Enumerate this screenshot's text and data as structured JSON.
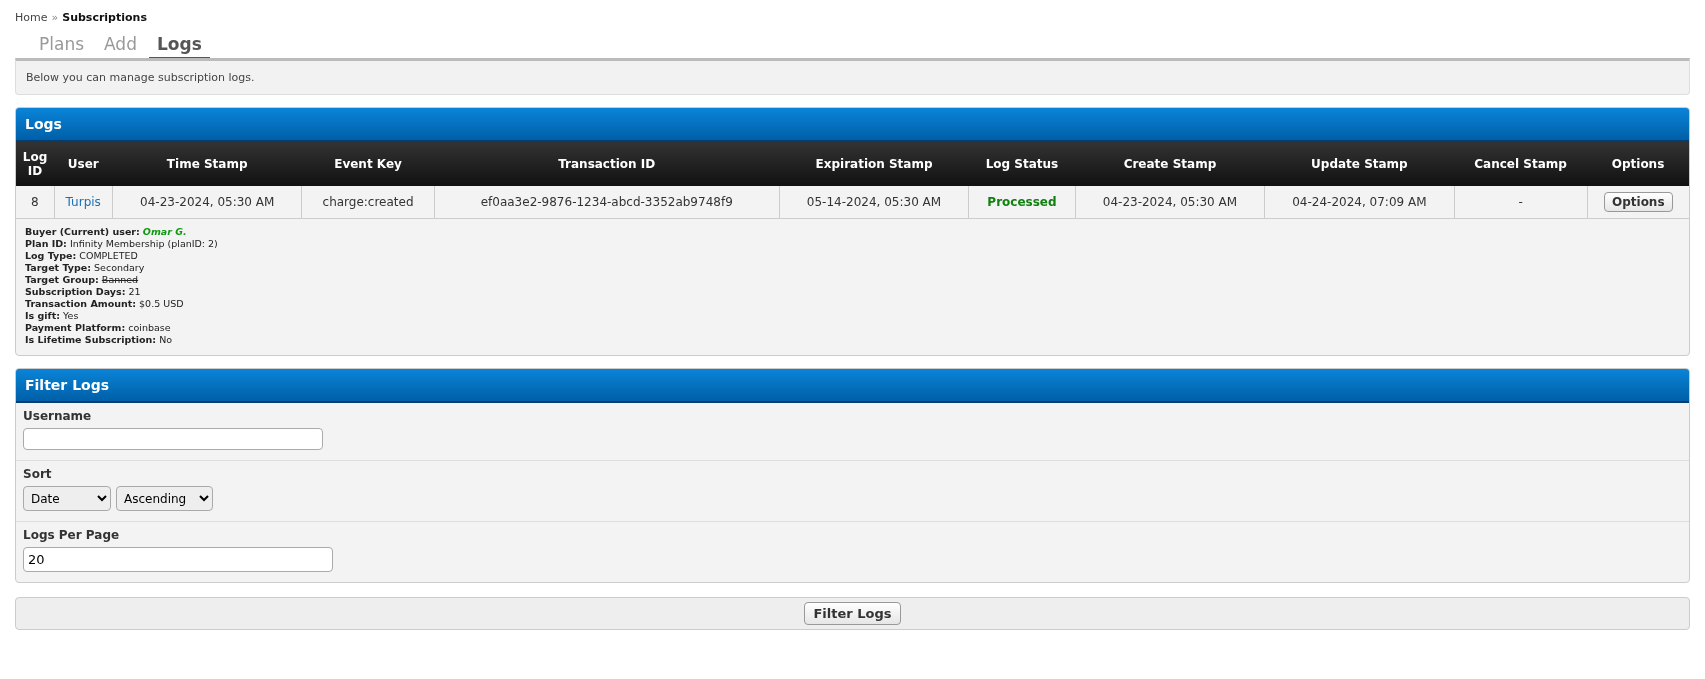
{
  "breadcrumb": {
    "items": [
      "Home"
    ],
    "separator": "»",
    "current": "Subscriptions"
  },
  "tabs": [
    {
      "label": "Plans",
      "selected": false
    },
    {
      "label": "Add",
      "selected": false
    },
    {
      "label": "Logs",
      "selected": true
    }
  ],
  "intro": "Below you can manage subscription logs.",
  "logs_panel": {
    "title": "Logs",
    "columns": [
      "Log ID",
      "User",
      "Time Stamp",
      "Event Key",
      "Transaction ID",
      "Expiration Stamp",
      "Log Status",
      "Create Stamp",
      "Update Stamp",
      "Cancel Stamp",
      "Options"
    ],
    "rows": [
      {
        "log_id": "8",
        "user": "Turpis",
        "time_stamp": "04-23-2024, 05:30 AM",
        "event_key": "charge:created",
        "transaction_id": "ef0aa3e2-9876-1234-abcd-3352ab9748f9",
        "expiration_stamp": "05-14-2024, 05:30 AM",
        "log_status": "Processed",
        "create_stamp": "04-23-2024, 05:30 AM",
        "update_stamp": "04-24-2024, 07:09 AM",
        "cancel_stamp": "-",
        "options_button": "Options",
        "details": [
          {
            "label": "Buyer (Current) user:",
            "value": "Omar G.",
            "kind": "user"
          },
          {
            "label": "Plan ID:",
            "value": "Infinity Membership (planID: 2)",
            "kind": "plain"
          },
          {
            "label": "Log Type:",
            "value": "COMPLETED",
            "kind": "plain"
          },
          {
            "label": "Target Type:",
            "value": "Secondary",
            "kind": "plain"
          },
          {
            "label": "Target Group:",
            "value": "Banned",
            "kind": "struck"
          },
          {
            "label": "Subscription Days:",
            "value": "21",
            "kind": "plain"
          },
          {
            "label": "Transaction Amount:",
            "value": "$0.5 USD",
            "kind": "plain"
          },
          {
            "label": "Is gift:",
            "value": "Yes",
            "kind": "plain"
          },
          {
            "label": "Payment Platform:",
            "value": "coinbase",
            "kind": "plain"
          },
          {
            "label": "Is Lifetime Subscription:",
            "value": "No",
            "kind": "plain"
          }
        ]
      }
    ]
  },
  "filter_panel": {
    "title": "Filter Logs",
    "username": {
      "label": "Username"
    },
    "sort": {
      "label": "Sort",
      "field": "Date",
      "order": "Ascending"
    },
    "per_page": {
      "label": "Logs Per Page",
      "value": "20"
    },
    "submit": "Filter Logs"
  }
}
